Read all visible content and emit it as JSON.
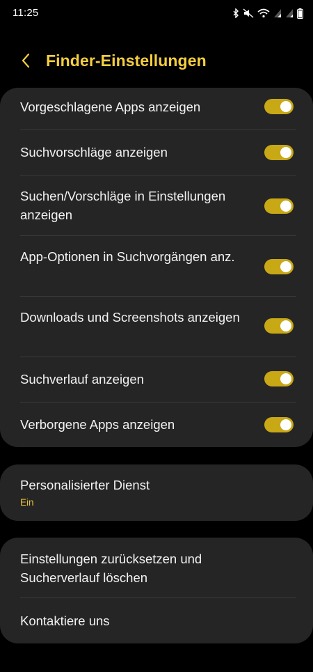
{
  "status_bar": {
    "time": "11:25",
    "icons": [
      "bluetooth-icon",
      "mute-icon",
      "wifi-icon",
      "signal-icon",
      "signal-icon",
      "battery-icon"
    ]
  },
  "header": {
    "title": "Finder-Einstellungen",
    "back_icon": "chevron-left-icon"
  },
  "toggles": [
    {
      "label": "Vorgeschlagene Apps anzeigen",
      "enabled": true
    },
    {
      "label": "Suchvorschläge anzeigen",
      "enabled": true
    },
    {
      "label": "Suchen/Vorschläge in Einstellungen anzeigen",
      "enabled": true
    },
    {
      "label": "App-Optionen in Suchvorgängen anz.",
      "enabled": true
    },
    {
      "label": "Downloads und Screenshots anzeigen",
      "enabled": true
    },
    {
      "label": "Suchverlauf anzeigen",
      "enabled": true
    },
    {
      "label": "Verborgene Apps anzeigen",
      "enabled": true
    }
  ],
  "personalized": {
    "label": "Personalisierter Dienst",
    "value": "Ein"
  },
  "actions": [
    {
      "label": "Einstellungen zurücksetzen und Sucherverlauf löschen"
    },
    {
      "label": "Kontaktiere uns"
    }
  ],
  "colors": {
    "background": "#000000",
    "card": "#252525",
    "accent": "#f5cf3e",
    "toggle_on": "#c9a816",
    "text": "#f2f2f2"
  }
}
